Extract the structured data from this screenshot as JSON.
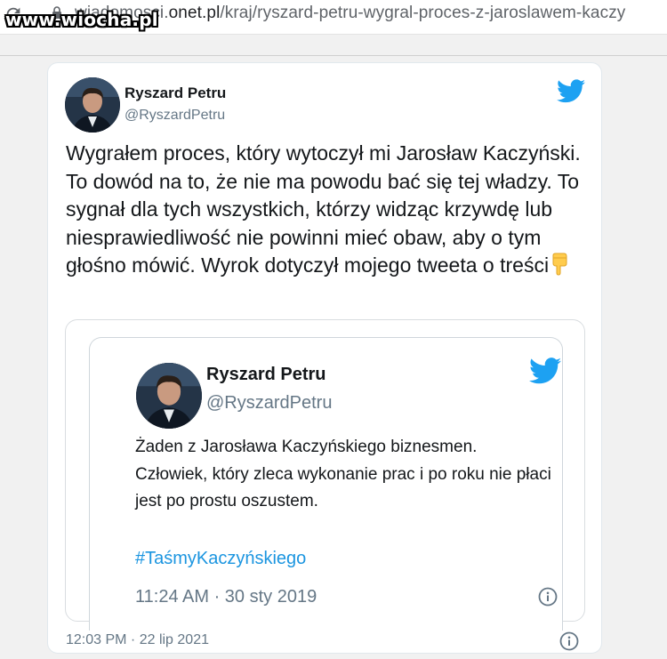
{
  "browser": {
    "url_prefix": "wiadomosci.",
    "url_domain": "onet.pl",
    "url_path": "/kraj/ryszard-petru-wygral-proces-z-jaroslawem-kaczy",
    "watermark": "www.wiocha.pl"
  },
  "tweet": {
    "name": "Ryszard Petru",
    "handle": "@RyszardPetru",
    "text": "Wygrałem proces, który wytoczył mi Jarosław Kaczyński. To dowód na to, że nie ma powodu bać się tej władzy. To sygnał dla tych wszystkich, którzy widząc krzywdę lub niesprawiedliwość nie powinni mieć obaw, aby o tym głośno mówić. Wyrok dotyczył mojego tweeta o treści",
    "emoji_icon": "backhand-index-pointing-down",
    "timestamp": "12:03 PM · 22 lip 2021",
    "icons": {
      "brand": "twitter-bird-icon",
      "info": "info-icon"
    },
    "accent_color": "#1da1f2"
  },
  "quoted_tweet": {
    "name": "Ryszard Petru",
    "handle": "@RyszardPetru",
    "text": "Żaden z Jarosława Kaczyńskiego biznesmen. Człowiek, który zleca wykonanie prac i po roku nie płaci jest po prostu oszustem.",
    "hashtag": "#TaśmyKaczyńskiego",
    "timestamp": "11:24 AM · 30 sty 2019",
    "hashtag_color": "#1b95e0"
  }
}
